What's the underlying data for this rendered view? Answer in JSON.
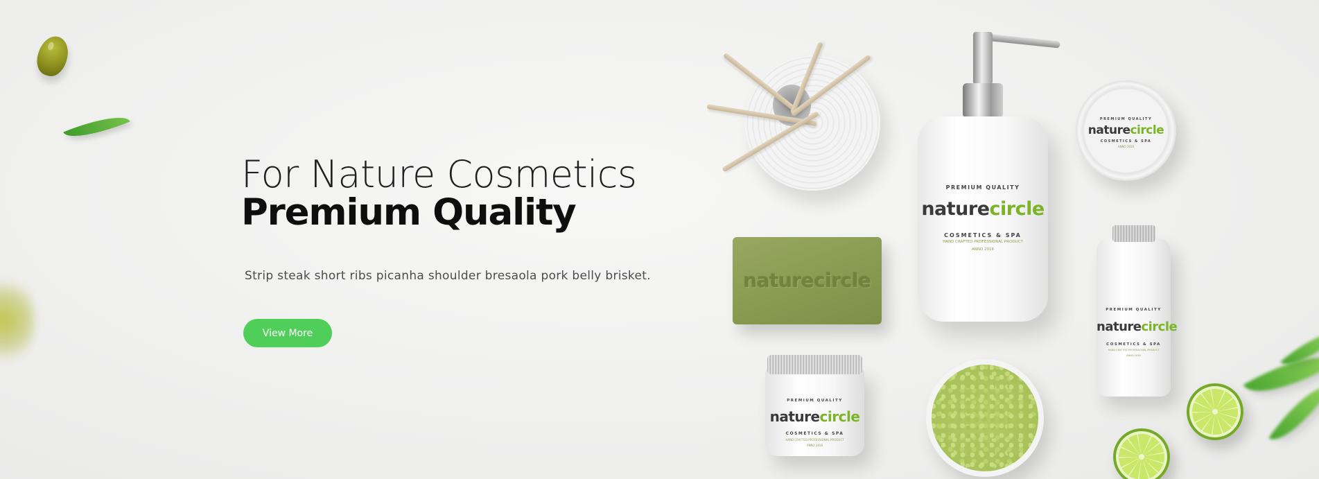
{
  "hero": {
    "heading_line1": "For Nature Cosmetics",
    "heading_line2": "Premium Quality",
    "description": "Strip steak short ribs picanha shoulder bresaola pork belly brisket.",
    "button_label": "View More",
    "accent_color": "#4fcf5a"
  },
  "product_branding": {
    "brand_prefix": "nature",
    "brand_suffix": "circle",
    "premium_quality": "PREMIUM QUALITY",
    "tagline": "COSMETICS & SPA",
    "subtagline": "HAND CRAFTED PROFESSIONAL PRODUCT",
    "anno": "ANNO 2016",
    "brand_green": "#7bb427"
  },
  "decorations": {
    "icons": [
      "olive-icon",
      "leaf-icon",
      "lime-icon",
      "reed-diffuser-image",
      "soap-bar-image",
      "pump-bottle-image",
      "tin-image",
      "jar-image",
      "salt-bowl-image",
      "small-bottle-image"
    ]
  }
}
